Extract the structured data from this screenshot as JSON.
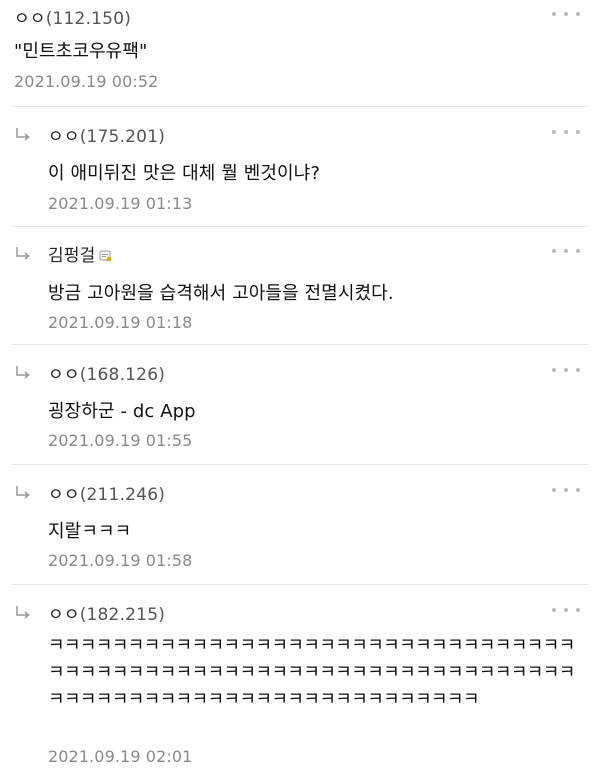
{
  "comments": [
    {
      "nick": "ㅇㅇ",
      "ip": "(112.150)",
      "text": "\"민트초코우유팩\"",
      "date": "2021.09.19 00:52",
      "is_reply": false
    },
    {
      "nick": "ㅇㅇ",
      "ip": "(175.201)",
      "text": "이 애미뒤진 맛은 대체 뭘 벤것이냐?",
      "date": "2021.09.19 01:13",
      "is_reply": true
    },
    {
      "nick": "김펑걸",
      "ip": "",
      "text": "방금 고아원을 습격해서 고아들을 전멸시켰다.",
      "date": "2021.09.19 01:18",
      "is_reply": true,
      "badge_icon": "fixed-nick-badge-icon"
    },
    {
      "nick": "ㅇㅇ",
      "ip": "(168.126)",
      "text": "굉장하군 - dc App",
      "date": "2021.09.19 01:55",
      "is_reply": true
    },
    {
      "nick": "ㅇㅇ",
      "ip": "(211.246)",
      "text": "지랄ㅋㅋㅋ",
      "date": "2021.09.19 01:58",
      "is_reply": true
    },
    {
      "nick": "ㅇㅇ",
      "ip": "(182.215)",
      "text": "ㅋㅋㅋㅋㅋㅋㅋㅋㅋㅋㅋㅋㅋㅋㅋㅋㅋㅋㅋㅋㅋㅋㅋㅋㅋㅋㅋㅋㅋㅋㅋㅋㅋㅋㅋㅋㅋㅋㅋㅋㅋㅋㅋㅋㅋㅋㅋㅋㅋㅋㅋㅋㅋㅋㅋㅋㅋㅋㅋㅋㅋㅋㅋㅋㅋㅋㅋㅋㅋㅋㅋㅋㅋㅋㅋㅋㅋㅋㅋㅋㅋㅋㅋㅋㅋㅋㅋㅋㅋㅋㅋㅋㅋ",
      "date": "2021.09.19 02:01",
      "is_reply": true
    }
  ],
  "icons": {
    "reply": "reply-arrow-icon",
    "more": "more-options-icon"
  },
  "colors": {
    "date": "#8a8a8a",
    "divider": "#e6e6e6",
    "dots": "#b8b8b8"
  }
}
